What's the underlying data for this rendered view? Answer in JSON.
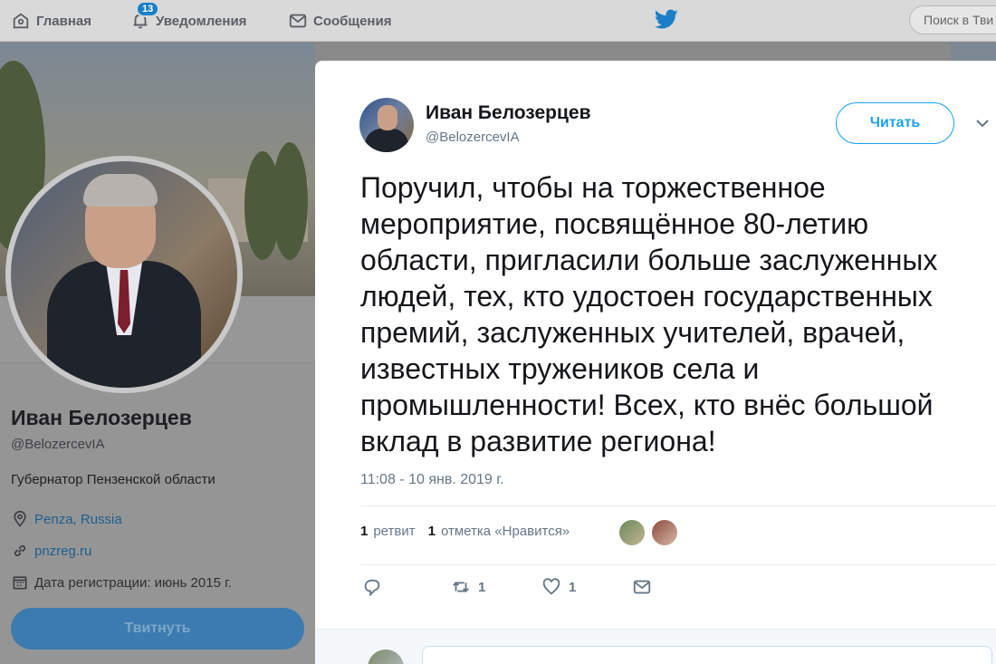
{
  "nav": {
    "home_label": "Главная",
    "notifications_label": "Уведомления",
    "notifications_count": "13",
    "messages_label": "Сообщения",
    "search_placeholder": "Поиск в Тви"
  },
  "profile": {
    "name": "Иван Белозерцев",
    "handle": "@BelozercevIA",
    "bio": "Губернатор Пензенской области",
    "location": "Penza, Russia",
    "website": "pnzreg.ru",
    "joined": "Дата регистрации: июнь 2015 г.",
    "tweet_button": "Твитнуть"
  },
  "tweet": {
    "author_name": "Иван Белозерцев",
    "author_handle": "@BelozercevIA",
    "follow_label": "Читать",
    "text": "Поручил, чтобы на торжественное мероприятие, посвящённое 80-летию области, пригласили больше заслуженных людей, тех, кто удостоен государственных премий, заслуженных учителей, врачей, известных тружеников села и промышленности! Всех, кто внёс большой вклад в развитие региона!",
    "timestamp": "11:08 - 10 янв. 2019 г.",
    "retweets_count": "1",
    "retweets_label": "ретвит",
    "likes_count": "1",
    "likes_label": "отметка «Нравится»",
    "action_retweet_count": "1",
    "action_like_count": "1"
  },
  "colors": {
    "accent": "#1da1f2",
    "text_primary": "#14171a",
    "text_secondary": "#657786"
  }
}
